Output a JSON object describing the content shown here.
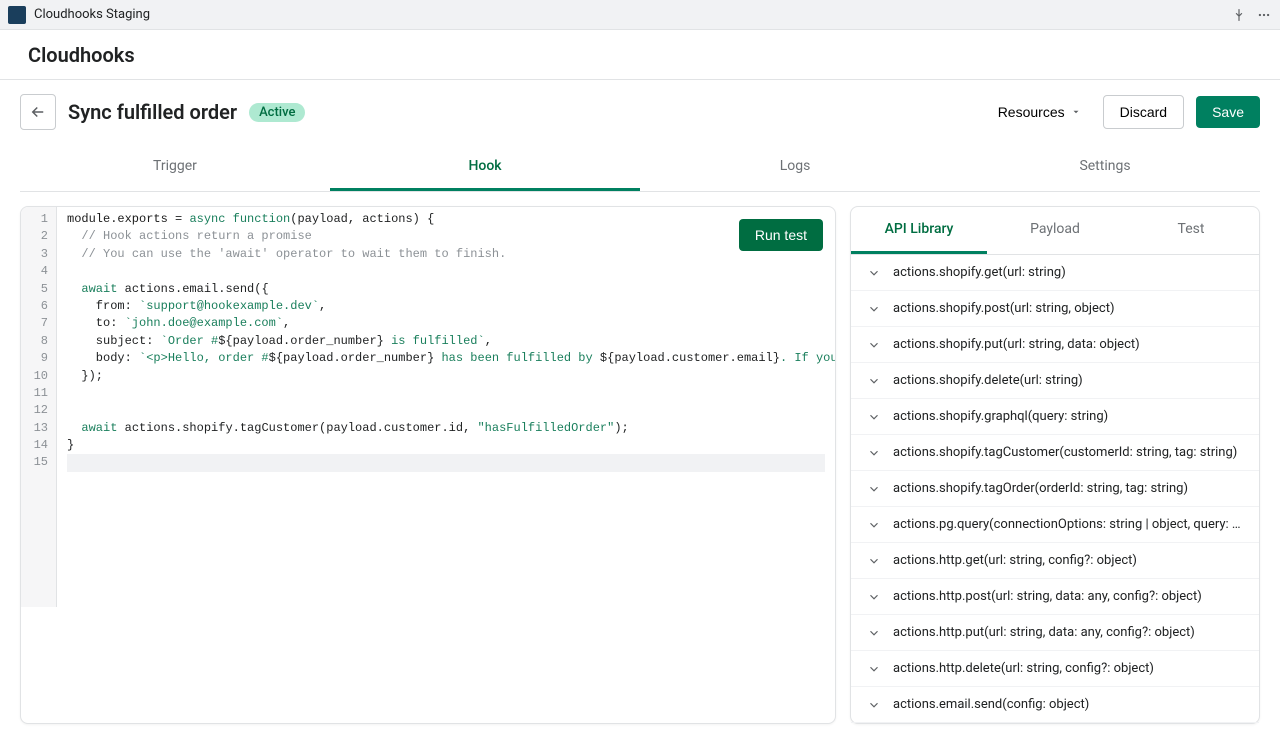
{
  "topbar": {
    "title": "Cloudhooks Staging"
  },
  "header": {
    "brand": "Cloudhooks"
  },
  "toolbar": {
    "page_title": "Sync fulfilled order",
    "badge": "Active",
    "resources": "Resources",
    "discard": "Discard",
    "save": "Save"
  },
  "tabs": {
    "main": [
      "Trigger",
      "Hook",
      "Logs",
      "Settings"
    ],
    "main_active": 1,
    "side": [
      "API Library",
      "Payload",
      "Test"
    ],
    "side_active": 0
  },
  "editor": {
    "run_label": "Run test",
    "lines": [
      "module.exports = async function(payload, actions) {",
      "  // Hook actions return a promise",
      "  // You can use the 'await' operator to wait them to finish.",
      "",
      "  await actions.email.send({",
      "    from: `support@hookexample.dev`,",
      "    to: `john.doe@example.com`,",
      "    subject: `Order #${payload.order_number} is fulfilled`,",
      "    body: `<p>Hello, order #${payload.order_number} has been fulfilled by ${payload.customer.email}. If you have questions, please email",
      "  });",
      "",
      "",
      "  await actions.shopify.tagCustomer(payload.customer.id, \"hasFulfilledOrder\");",
      "}",
      ""
    ]
  },
  "api": [
    "actions.shopify.get(url: string)",
    "actions.shopify.post(url: string, object)",
    "actions.shopify.put(url: string, data: object)",
    "actions.shopify.delete(url: string)",
    "actions.shopify.graphql(query: string)",
    "actions.shopify.tagCustomer(customerId: string, tag: string)",
    "actions.shopify.tagOrder(orderId: string, tag: string)",
    "actions.pg.query(connectionOptions: string | object, query: string...",
    "actions.http.get(url: string, config?: object)",
    "actions.http.post(url: string, data: any, config?: object)",
    "actions.http.put(url: string, data: any, config?: object)",
    "actions.http.delete(url: string, config?: object)",
    "actions.email.send(config: object)"
  ]
}
